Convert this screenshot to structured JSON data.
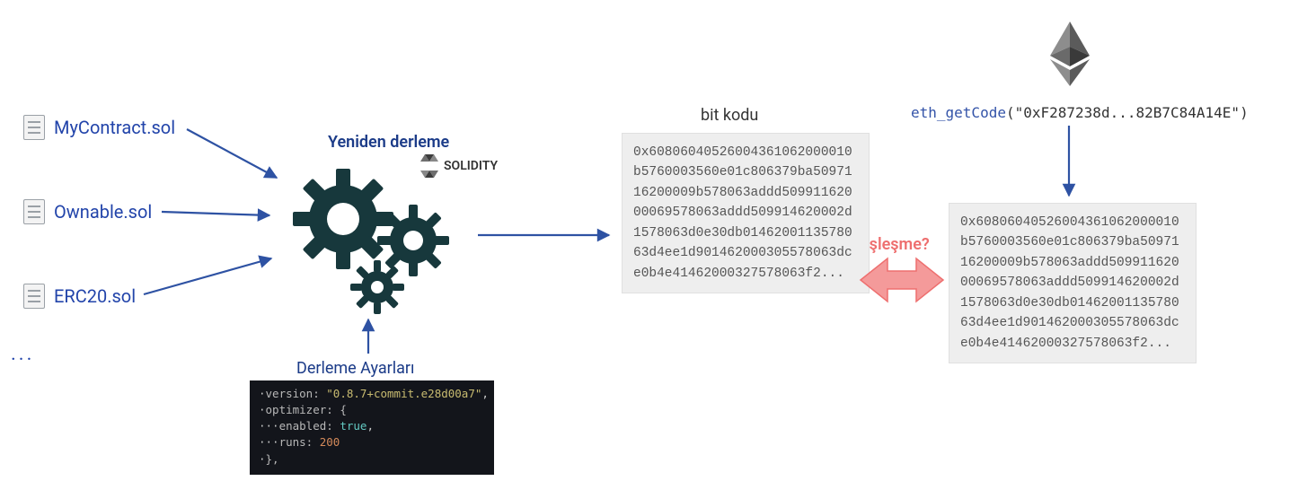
{
  "files": {
    "f1": "MyContract.sol",
    "f2": "Ownable.sol",
    "f3": "ERC20.sol",
    "ellipsis": "..."
  },
  "labels": {
    "compile": "Yeniden derleme",
    "solidity": "SOLIDITY",
    "settings": "Derleme Ayarları",
    "bytecode": "bit kodu",
    "match": "eşleşme?"
  },
  "rpc": {
    "method": "eth_getCode",
    "address": "\"0xF287238d...82B7C84A14E\""
  },
  "bytecode": "0x60806040526004361062000010b5760003560e01c806379ba5097116200009b578063addd50991162000069578063addd509914620002d1578063d0e30db0146200113578063d4ee1d901462000305578063dce0b4e41462000327578063f2...",
  "settings_code": {
    "line1_key": "version:",
    "line1_val": "\"0.8.7+commit.e28d00a7\"",
    "line1_tail": ",",
    "line2": "optimizer: {",
    "line3_key": "enabled:",
    "line3_val": "true",
    "line3_tail": ",",
    "line4_key": "runs:",
    "line4_val": "200",
    "line5": "},"
  }
}
